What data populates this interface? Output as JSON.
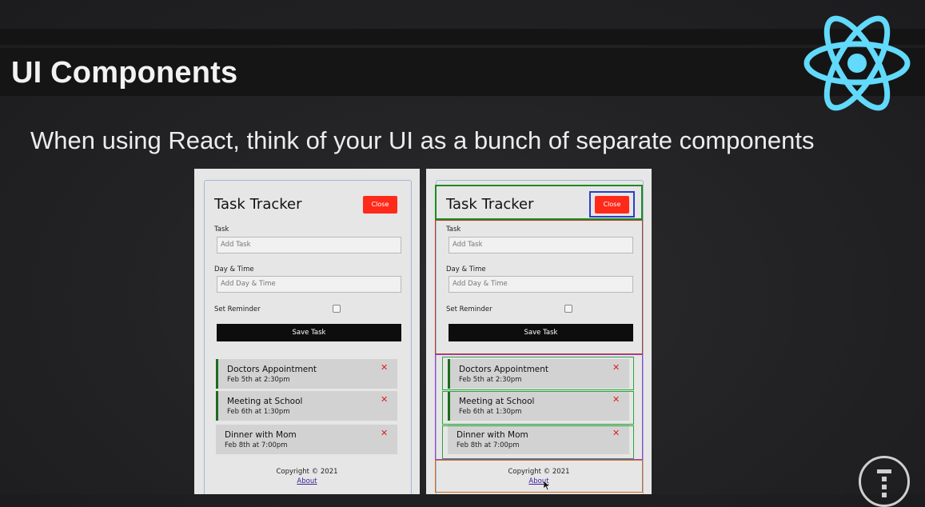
{
  "slide": {
    "title": "UI Components",
    "subtitle": "When using React, think of your UI as a bunch of separate components"
  },
  "icons": {
    "logo": "react-atom-icon",
    "badge": "channel-logo-icon"
  },
  "colors": {
    "react": "#61dafb",
    "close_button": "#ff2a1a",
    "header_box": "#1f8a1f",
    "button_box": "#2a3fc9",
    "form_box": "#b83a2a",
    "tasks_box": "#9a3fd1",
    "task_box": "#2aa63a",
    "footer_box": "#d4691f"
  },
  "app": {
    "title": "Task Tracker",
    "close_label": "Close",
    "form": {
      "task_label": "Task",
      "task_placeholder": "Add Task",
      "day_label": "Day & Time",
      "day_placeholder": "Add Day & Time",
      "reminder_label": "Set Reminder",
      "save_label": "Save Task"
    },
    "tasks": [
      {
        "text": "Doctors Appointment",
        "day": "Feb 5th at 2:30pm",
        "reminder": true
      },
      {
        "text": "Meeting at School",
        "day": "Feb 6th at 1:30pm",
        "reminder": true
      },
      {
        "text": "Dinner with Mom",
        "day": "Feb 8th at 7:00pm",
        "reminder": false
      }
    ],
    "delete_glyph": "✕",
    "footer": {
      "copyright": "Copyright © 2021",
      "about": "About"
    }
  }
}
